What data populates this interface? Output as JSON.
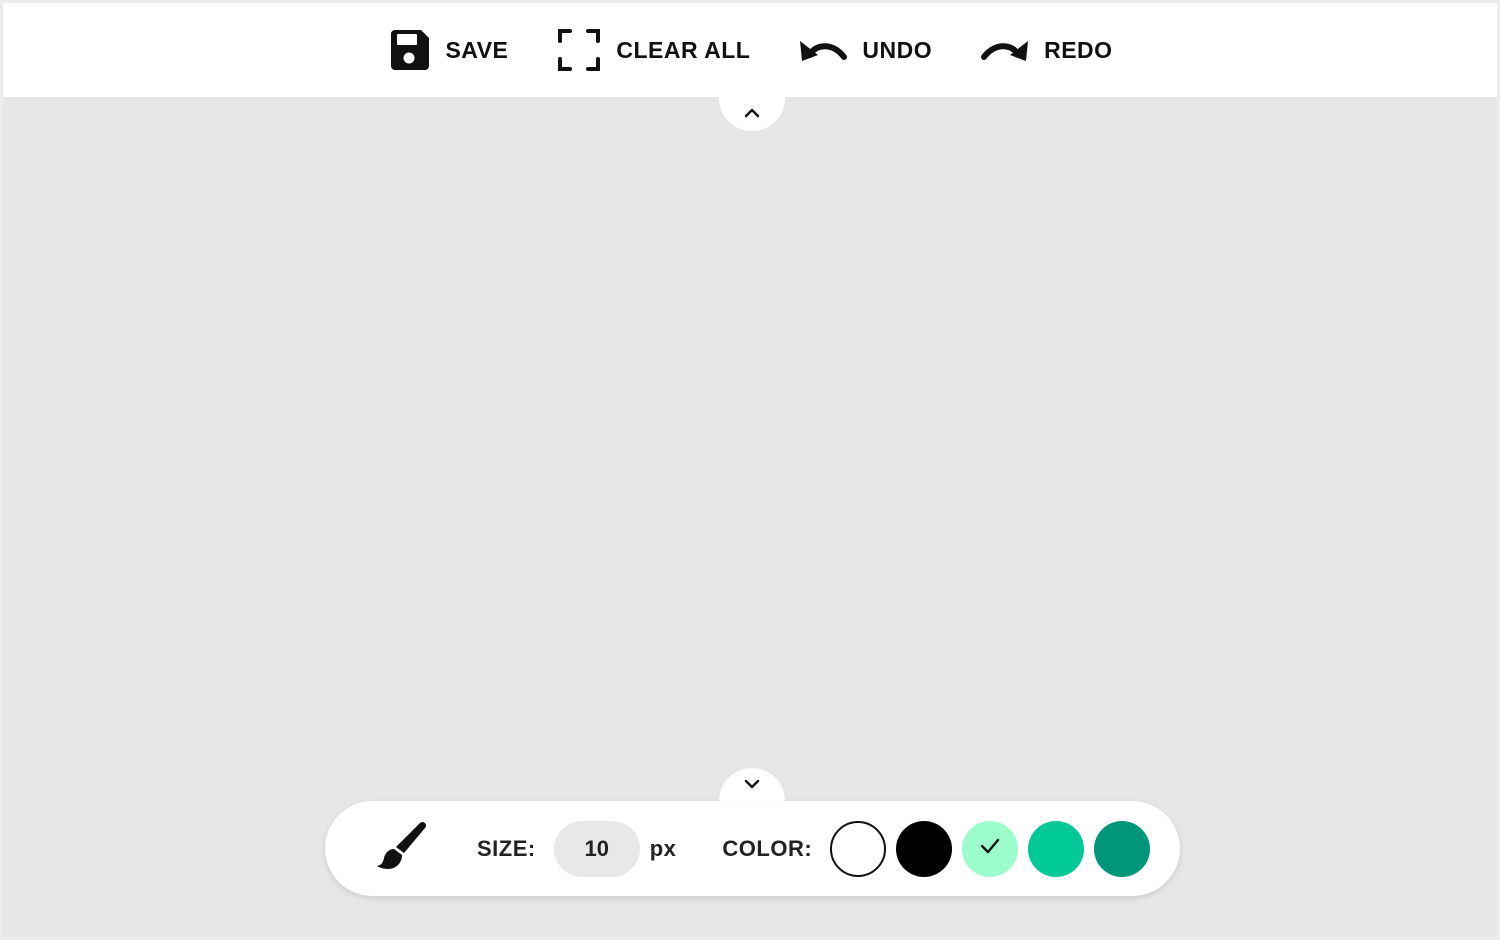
{
  "toolbar": {
    "save_label": "SAVE",
    "clear_label": "CLEAR ALL",
    "undo_label": "UNDO",
    "redo_label": "REDO"
  },
  "palette": {
    "size_label": "SIZE:",
    "size_value": "10",
    "size_unit": "px",
    "color_label": "COLOR:",
    "colors": [
      {
        "name": "white",
        "hex": "#ffffff",
        "selected": false
      },
      {
        "name": "black",
        "hex": "#000000",
        "selected": false
      },
      {
        "name": "mint",
        "hex": "#9dfccc",
        "selected": true
      },
      {
        "name": "teal",
        "hex": "#00c896",
        "selected": false
      },
      {
        "name": "dark-teal",
        "hex": "#00967a",
        "selected": false
      }
    ]
  },
  "icons": {
    "save": "save-icon",
    "clear": "fullscreen-brackets-icon",
    "undo": "undo-arrow-icon",
    "redo": "redo-arrow-icon",
    "brush": "paintbrush-icon",
    "collapse_up": "chevron-up-icon",
    "collapse_down": "chevron-down-icon",
    "selected_check": "checkmark-icon"
  }
}
